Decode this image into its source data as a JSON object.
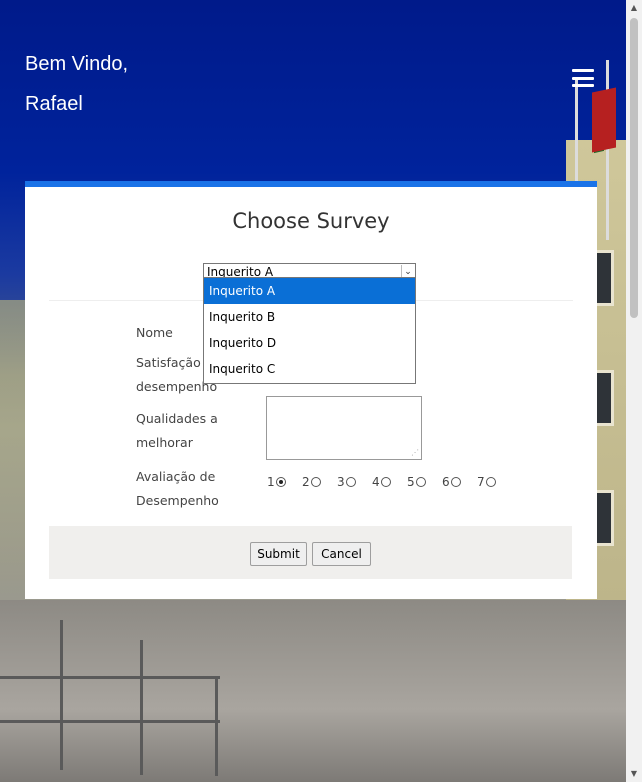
{
  "header": {
    "greeting_line1": "Bem Vindo,",
    "greeting_line2": "Rafael"
  },
  "card": {
    "title": "Choose Survey",
    "accent_color": "#1a73e8",
    "survey_select": {
      "selected": "Inquerito A",
      "options": [
        "Inquerito A",
        "Inquerito B",
        "Inquerito D",
        "Inquerito C"
      ],
      "highlighted_option": "Inquerito A"
    },
    "form": {
      "nome_label": "Nome",
      "satisfacao_label_line1": "Satisfação",
      "satisfacao_label_line2": "desempenho",
      "qualidades_label_line1": "Qualidades a",
      "qualidades_label_line2": "melhorar",
      "avaliacao_label_line1": "Avaliação de",
      "avaliacao_label_line2": "Desempenho",
      "rating_options": [
        "1",
        "2",
        "3",
        "4",
        "5",
        "6",
        "7"
      ],
      "rating_selected": "1"
    },
    "buttons": {
      "submit": "Submit",
      "cancel": "Cancel"
    }
  },
  "icons": {
    "menu": "hamburger-menu-icon",
    "dropdown_arrow": "chevron-down-icon"
  }
}
